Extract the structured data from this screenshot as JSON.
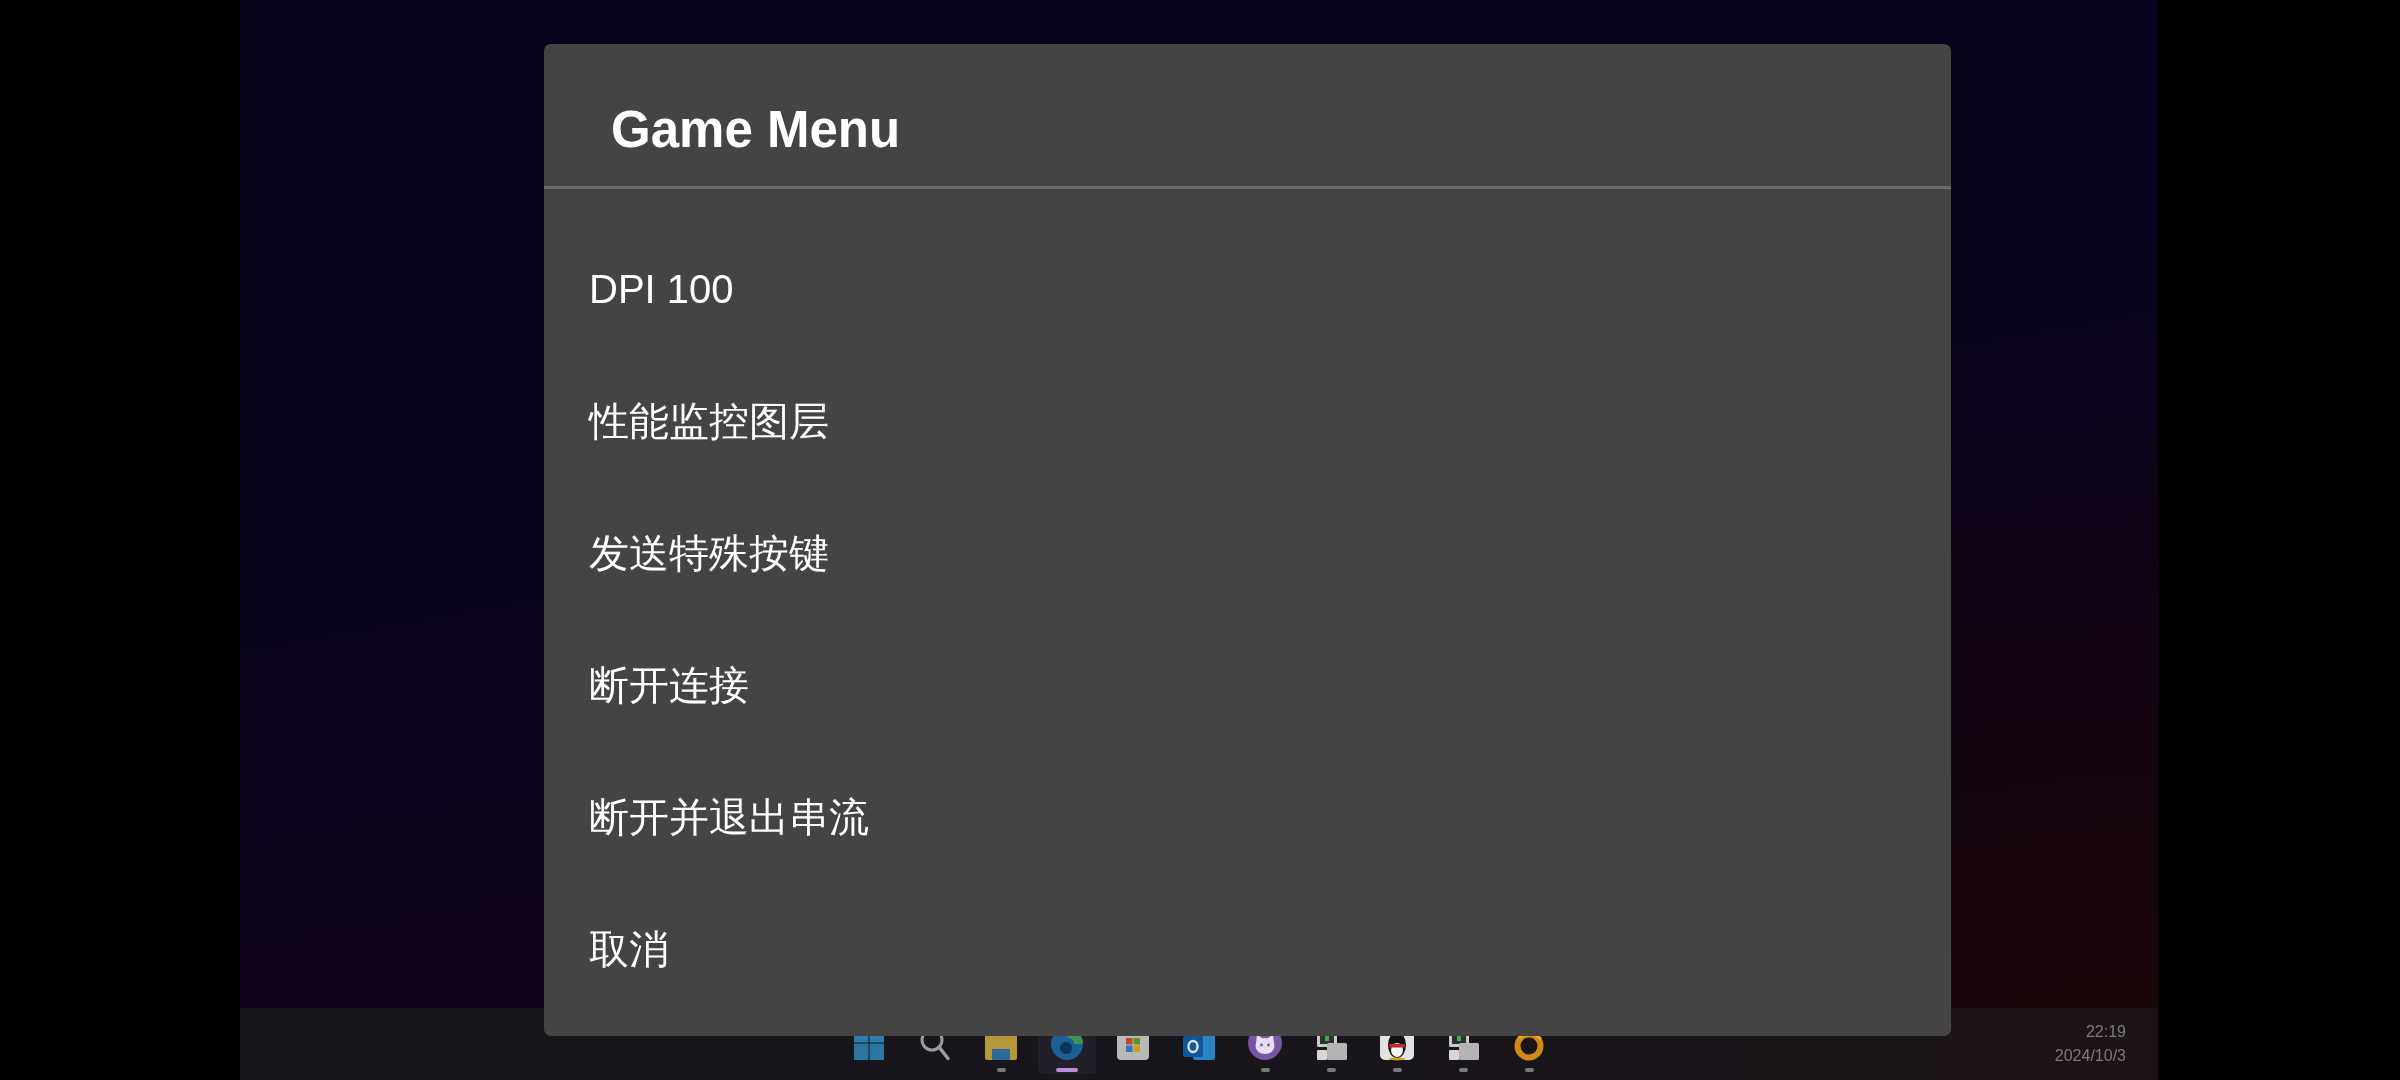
{
  "dialog": {
    "title": "Game Menu",
    "items": [
      {
        "label": "DPI 100"
      },
      {
        "label": "性能监控图层"
      },
      {
        "label": "发送特殊按键"
      },
      {
        "label": "断开连接"
      },
      {
        "label": "断开并退出串流"
      },
      {
        "label": "取消"
      }
    ]
  },
  "taskbar": {
    "apps": [
      {
        "kind": "grid",
        "running": false,
        "active": false
      },
      {
        "kind": "search",
        "running": false,
        "active": false
      },
      {
        "kind": "folder",
        "running": true,
        "active": false
      },
      {
        "kind": "swirl",
        "running": true,
        "active": true
      },
      {
        "kind": "tiles",
        "running": false,
        "active": false
      },
      {
        "kind": "mail",
        "running": false,
        "active": false
      },
      {
        "kind": "cat",
        "running": true,
        "active": false
      },
      {
        "kind": "computer",
        "running": true,
        "active": false
      },
      {
        "kind": "penguin",
        "running": true,
        "active": false
      },
      {
        "kind": "computer",
        "running": true,
        "active": false
      },
      {
        "kind": "ring",
        "running": true,
        "active": false
      }
    ],
    "clock": {
      "time": "22:19",
      "date": "2024/10/3"
    }
  }
}
